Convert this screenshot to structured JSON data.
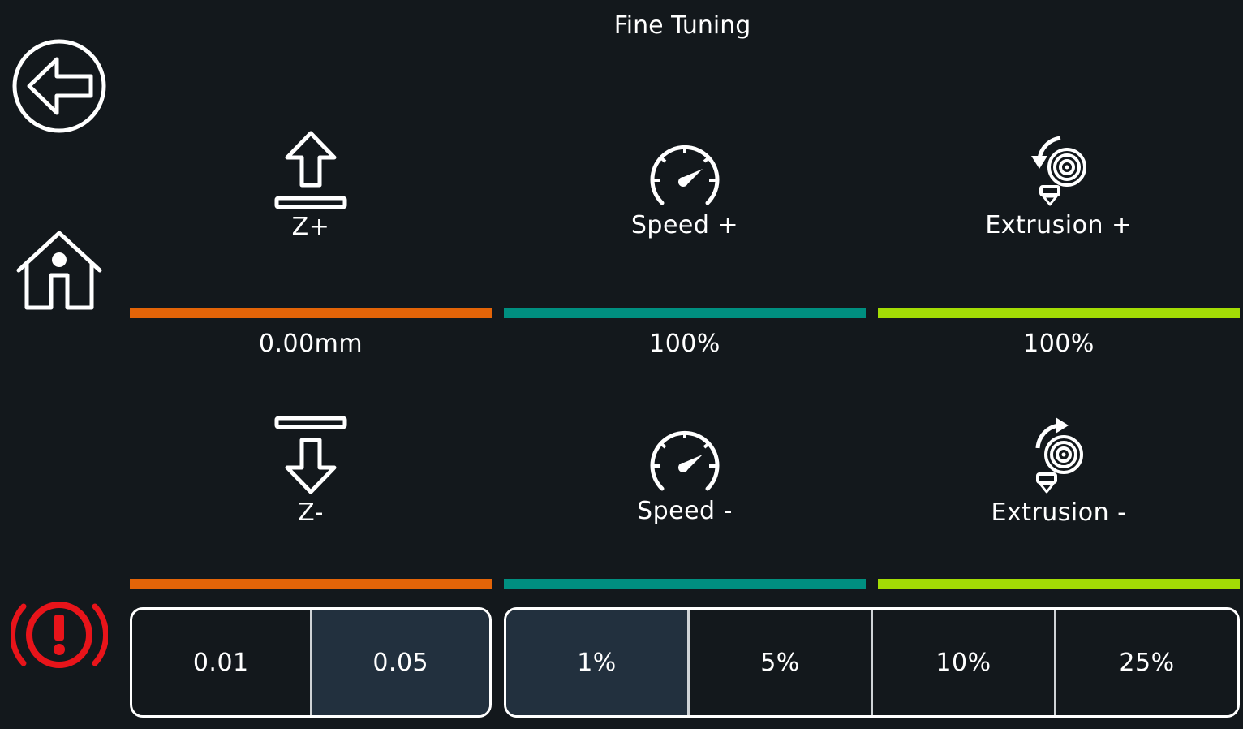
{
  "title": "Fine Tuning",
  "sidebar": {
    "back_icon": "back-arrow-icon",
    "home_icon": "home-icon",
    "estop_icon": "emergency-stop-icon"
  },
  "controls": {
    "z_up": {
      "label": "Z+",
      "icon": "z-up-icon"
    },
    "speed_up": {
      "label": "Speed +",
      "icon": "speedometer-icon"
    },
    "extrusion_up": {
      "label": "Extrusion +",
      "icon": "extrusion-retract-icon"
    },
    "z_down": {
      "label": "Z-",
      "icon": "z-down-icon"
    },
    "speed_down": {
      "label": "Speed -",
      "icon": "speedometer-icon"
    },
    "extrusion_down": {
      "label": "Extrusion -",
      "icon": "extrusion-extrude-icon"
    }
  },
  "values": {
    "z_offset": "0.00mm",
    "speed": "100%",
    "extrusion": "100%"
  },
  "z_steps": {
    "options": [
      "0.01",
      "0.05"
    ],
    "selected": "0.05"
  },
  "percent_steps": {
    "options": [
      "1%",
      "5%",
      "10%",
      "25%"
    ],
    "selected": "1%"
  },
  "colors": {
    "background": "#13181c",
    "z_accent": "#e36408",
    "speed_accent": "#008f80",
    "extrusion_accent": "#a3dc05",
    "estop": "#e8141a",
    "selected_segment": "#22303e"
  }
}
